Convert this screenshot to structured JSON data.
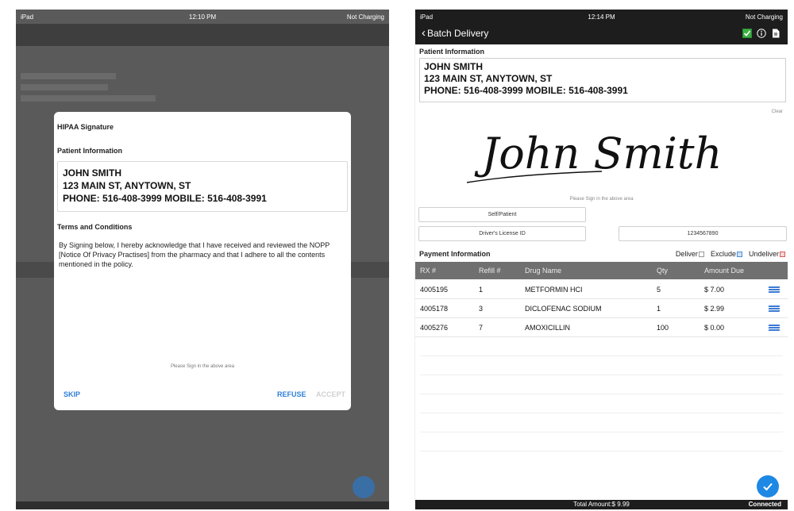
{
  "left": {
    "status": {
      "device": "iPad",
      "time": "12:10 PM",
      "battery": "Not Charging"
    },
    "modal": {
      "title": "HIPAA Signature",
      "patient_section": "Patient Information",
      "patient_lines": [
        "JOHN SMITH",
        "123 MAIN ST, ANYTOWN, ST",
        "PHONE: 516-408-3999 MOBILE: 516-408-3991"
      ],
      "terms_section": "Terms and Conditions",
      "terms_text": "By Signing below, I hereby acknowledge that I have received and reviewed the NOPP  [Notice Of Privacy Practises] from the pharmacy  and that I adhere to all the  contents mentioned in the policy.",
      "hint": "Please Sign in the above area",
      "skip": "SKIP",
      "refuse": "REFUSE",
      "accept": "ACCEPT"
    }
  },
  "right": {
    "status": {
      "device": "iPad",
      "time": "12:14 PM",
      "battery": "Not Charging"
    },
    "nav": {
      "back_label": "Batch Delivery"
    },
    "patient_section": "Patient Information",
    "patient_lines": [
      "JOHN SMITH",
      "123 MAIN ST, ANYTOWN, ST",
      "PHONE: 516-408-3999 MOBILE: 516-408-3991"
    ],
    "clear": "Clear",
    "signature_name": "John Smith",
    "sign_hint": "Please Sign in the above area",
    "relationship": "Self/Patient",
    "id_type": "Driver's License ID",
    "id_number": "1234567890",
    "payment": {
      "title": "Payment Information",
      "options": [
        "Deliver",
        "Exclude",
        "Undeliver"
      ],
      "columns": [
        "RX #",
        "Refill #",
        "Drug Name",
        "Qty",
        "Amount Due"
      ],
      "rows": [
        {
          "rx": "4005195",
          "refill": "1",
          "drug": "METFORMIN HCI",
          "qty": "5",
          "amount": "$ 7.00"
        },
        {
          "rx": "4005178",
          "refill": "3",
          "drug": "DICLOFENAC SODIUM",
          "qty": "1",
          "amount": "$ 2.99"
        },
        {
          "rx": "4005276",
          "refill": "7",
          "drug": "AMOXICILLIN",
          "qty": "100",
          "amount": "$ 0.00"
        }
      ]
    },
    "total": "Total Amount:$ 9.99",
    "connection": "Connected",
    "colors": {
      "accent": "#1e88e5",
      "nav": "#1d1d1d",
      "table_header": "#707070"
    }
  }
}
